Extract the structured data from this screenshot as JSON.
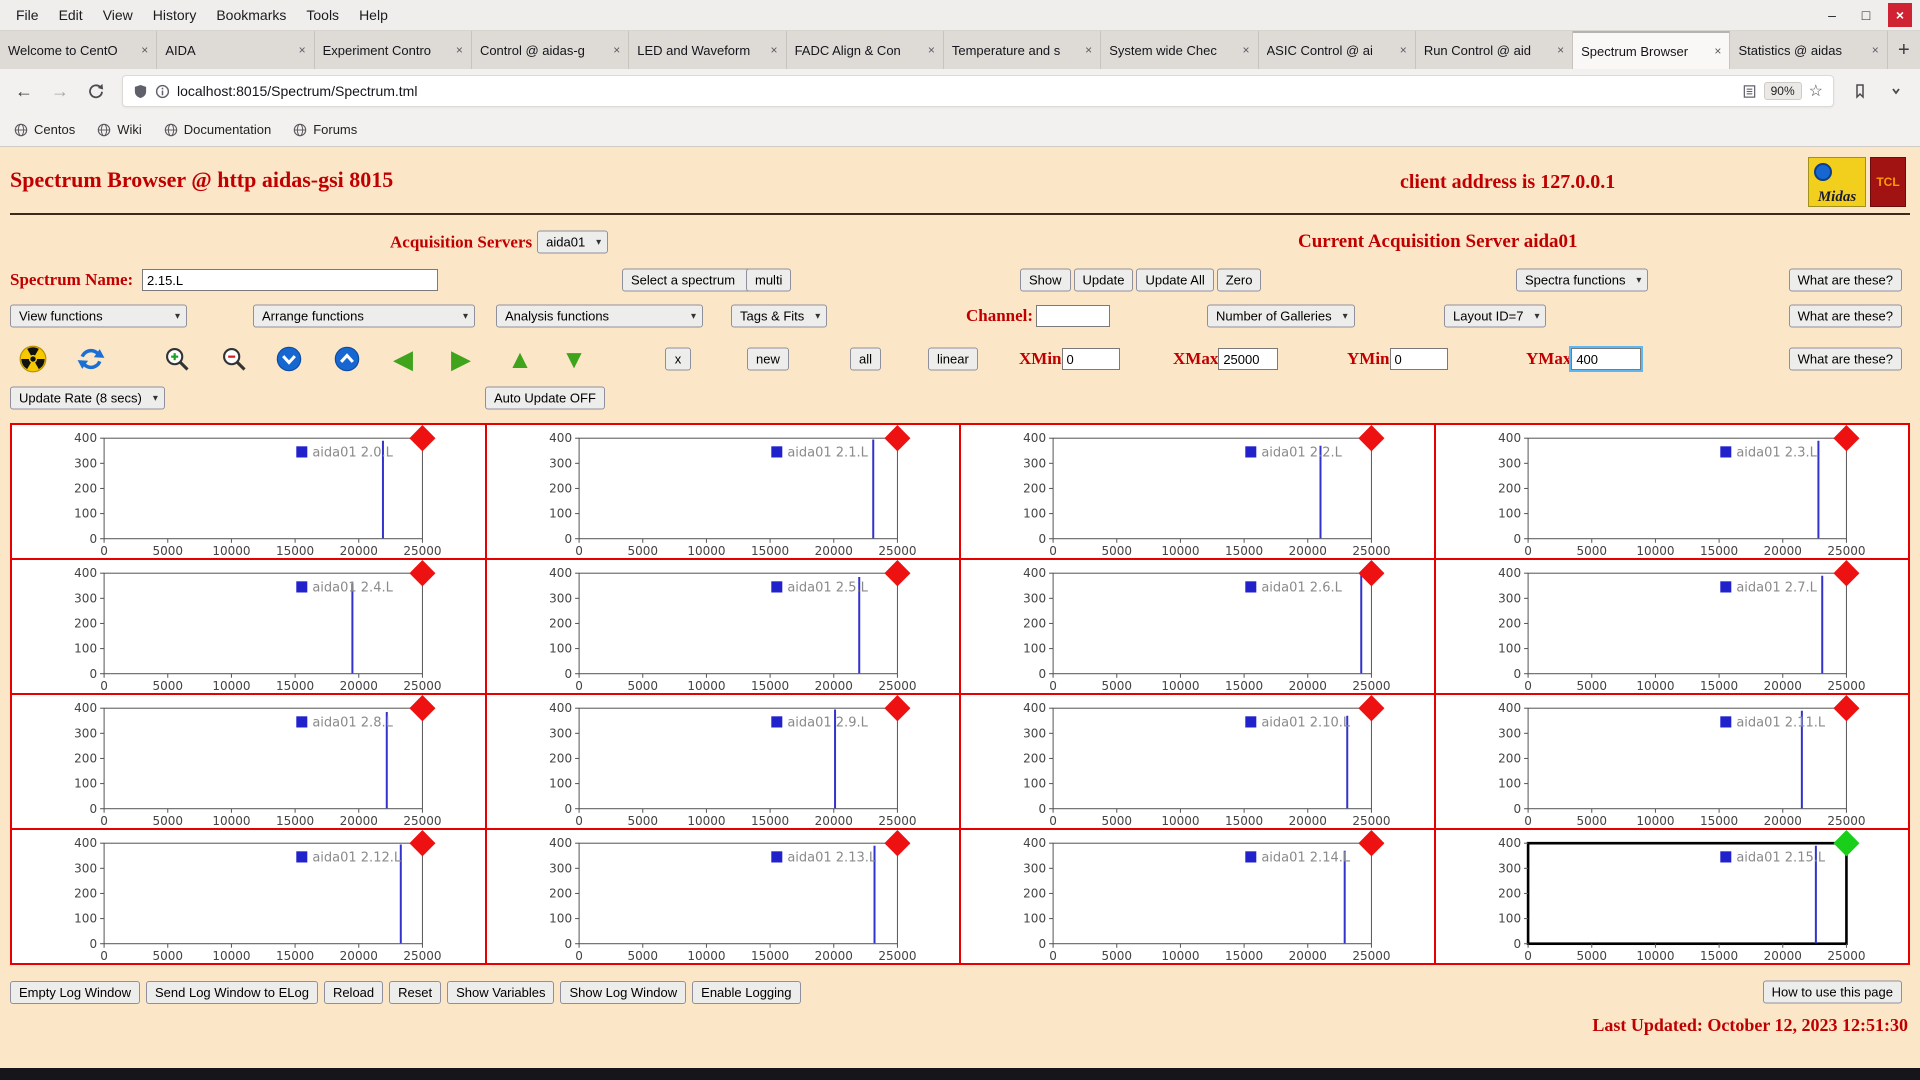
{
  "icons": {
    "minimize": "–",
    "maximize": "□",
    "close": "×",
    "back": "←",
    "forward": "→",
    "star": "☆",
    "new_tab": "+",
    "arrow_left": "◀",
    "arrow_right": "▶",
    "arrow_up": "▲",
    "arrow_down": "▼"
  },
  "browser": {
    "menu_items": [
      "File",
      "Edit",
      "View",
      "History",
      "Bookmarks",
      "Tools",
      "Help"
    ],
    "tabs": [
      {
        "label": "Welcome to CentO",
        "active": false
      },
      {
        "label": "AIDA",
        "active": false
      },
      {
        "label": "Experiment Contro",
        "active": false
      },
      {
        "label": "Control @ aidas-g",
        "active": false
      },
      {
        "label": "LED and Waveform",
        "active": false
      },
      {
        "label": "FADC Align & Con",
        "active": false
      },
      {
        "label": "Temperature and s",
        "active": false
      },
      {
        "label": "System wide Chec",
        "active": false
      },
      {
        "label": "ASIC Control @ ai",
        "active": false
      },
      {
        "label": "Run Control @ aid",
        "active": false
      },
      {
        "label": "Spectrum Browser",
        "active": true
      },
      {
        "label": "Statistics @ aidas",
        "active": false
      }
    ],
    "nav": {
      "url": "localhost:8015/Spectrum/Spectrum.tml",
      "zoom_badge": "90%"
    },
    "bookmarks": [
      "Centos",
      "Wiki",
      "Documentation",
      "Forums"
    ]
  },
  "page": {
    "title": "Spectrum Browser @ http aidas-gsi 8015",
    "client_address": "client address is 127.0.0.1",
    "logos": {
      "midas": "Midas",
      "tcl": "TCL"
    },
    "acquisition_servers_label": "Acquisition Servers",
    "acquisition_server_value": "aida01",
    "current_server": "Current Acquisition Server aida01",
    "spectrum_name_label": "Spectrum Name:",
    "spectrum_name_value": "2.15.L",
    "select_spectrum": "Select a spectrum",
    "multi": "multi",
    "show": "Show",
    "update": "Update",
    "update_all": "Update All",
    "zero": "Zero",
    "spectra_functions": "Spectra functions",
    "what_are_these": "What are these?",
    "view_functions": "View functions",
    "arrange_functions": "Arrange functions",
    "analysis_functions": "Analysis functions",
    "tags_fits": "Tags & Fits",
    "channel_label": "Channel:",
    "channel_value": "",
    "number_of_galleries": "Number of Galleries",
    "layout_id": "Layout ID=7",
    "x_button": "x",
    "new_button": "new",
    "all_button": "all",
    "linear_button": "linear",
    "xmin_label": "XMin",
    "xmin_value": "0",
    "xmax_label": "XMax",
    "xmax_value": "25000",
    "ymin_label": "YMin",
    "ymin_value": "0",
    "ymax_label": "YMax",
    "ymax_value": "400",
    "update_rate": "Update Rate (8 secs)",
    "auto_update": "Auto Update OFF",
    "footer_buttons": [
      "Empty Log Window",
      "Send Log Window to ELog",
      "Reload",
      "Reset",
      "Show Variables",
      "Show Log Window",
      "Enable Logging"
    ],
    "how_to": "How to use this page",
    "last_updated": "Last Updated: October 12, 2023 12:51:30"
  },
  "chart_data": {
    "type": "line",
    "title": "spectrum gallery 4x4",
    "xlabel": "",
    "ylabel": "",
    "xlim": [
      0,
      25000
    ],
    "ylim": [
      0,
      400
    ],
    "xticks": [
      0,
      5000,
      10000,
      15000,
      20000,
      25000
    ],
    "yticks": [
      0,
      100,
      200,
      300,
      400
    ],
    "grid": false,
    "legend_position": "top-right",
    "line_color": "#3333cc",
    "legend_marker_color": "#2222cc",
    "corner_marker_color": "#ee1111",
    "selected_corner_marker_color": "#19cf1a",
    "plots": [
      {
        "id": "2.0.L",
        "legend": "aida01 2.0.L",
        "peak_x": 21900,
        "peak_y": 390,
        "selected": false
      },
      {
        "id": "2.1.L",
        "legend": "aida01 2.1.L",
        "peak_x": 23100,
        "peak_y": 395,
        "selected": false
      },
      {
        "id": "2.2.L",
        "legend": "aida01 2.2.L",
        "peak_x": 21000,
        "peak_y": 370,
        "selected": false
      },
      {
        "id": "2.3.L",
        "legend": "aida01 2.3.L",
        "peak_x": 22800,
        "peak_y": 390,
        "selected": false
      },
      {
        "id": "2.4.L",
        "legend": "aida01 2.4.L",
        "peak_x": 19500,
        "peak_y": 360,
        "selected": false
      },
      {
        "id": "2.5.L",
        "legend": "aida01 2.5.L",
        "peak_x": 22000,
        "peak_y": 385,
        "selected": false
      },
      {
        "id": "2.6.L",
        "legend": "aida01 2.6.L",
        "peak_x": 24200,
        "peak_y": 395,
        "selected": false
      },
      {
        "id": "2.7.L",
        "legend": "aida01 2.7.L",
        "peak_x": 23100,
        "peak_y": 390,
        "selected": false
      },
      {
        "id": "2.8.L",
        "legend": "aida01 2.8.L",
        "peak_x": 22200,
        "peak_y": 385,
        "selected": false
      },
      {
        "id": "2.9.L",
        "legend": "aida01 2.9.L",
        "peak_x": 20100,
        "peak_y": 395,
        "selected": false
      },
      {
        "id": "2.10.L",
        "legend": "aida01 2.10.L",
        "peak_x": 23100,
        "peak_y": 370,
        "selected": false
      },
      {
        "id": "2.11.L",
        "legend": "aida01 2.11.L",
        "peak_x": 21500,
        "peak_y": 390,
        "selected": false
      },
      {
        "id": "2.12.L",
        "legend": "aida01 2.12.L",
        "peak_x": 23300,
        "peak_y": 395,
        "selected": false
      },
      {
        "id": "2.13.L",
        "legend": "aida01 2.13.L",
        "peak_x": 23200,
        "peak_y": 390,
        "selected": false
      },
      {
        "id": "2.14.L",
        "legend": "aida01 2.14.L",
        "peak_x": 22900,
        "peak_y": 370,
        "selected": false
      },
      {
        "id": "2.15.L",
        "legend": "aida01 2.15.L",
        "peak_x": 22600,
        "peak_y": 390,
        "selected": true
      }
    ]
  }
}
